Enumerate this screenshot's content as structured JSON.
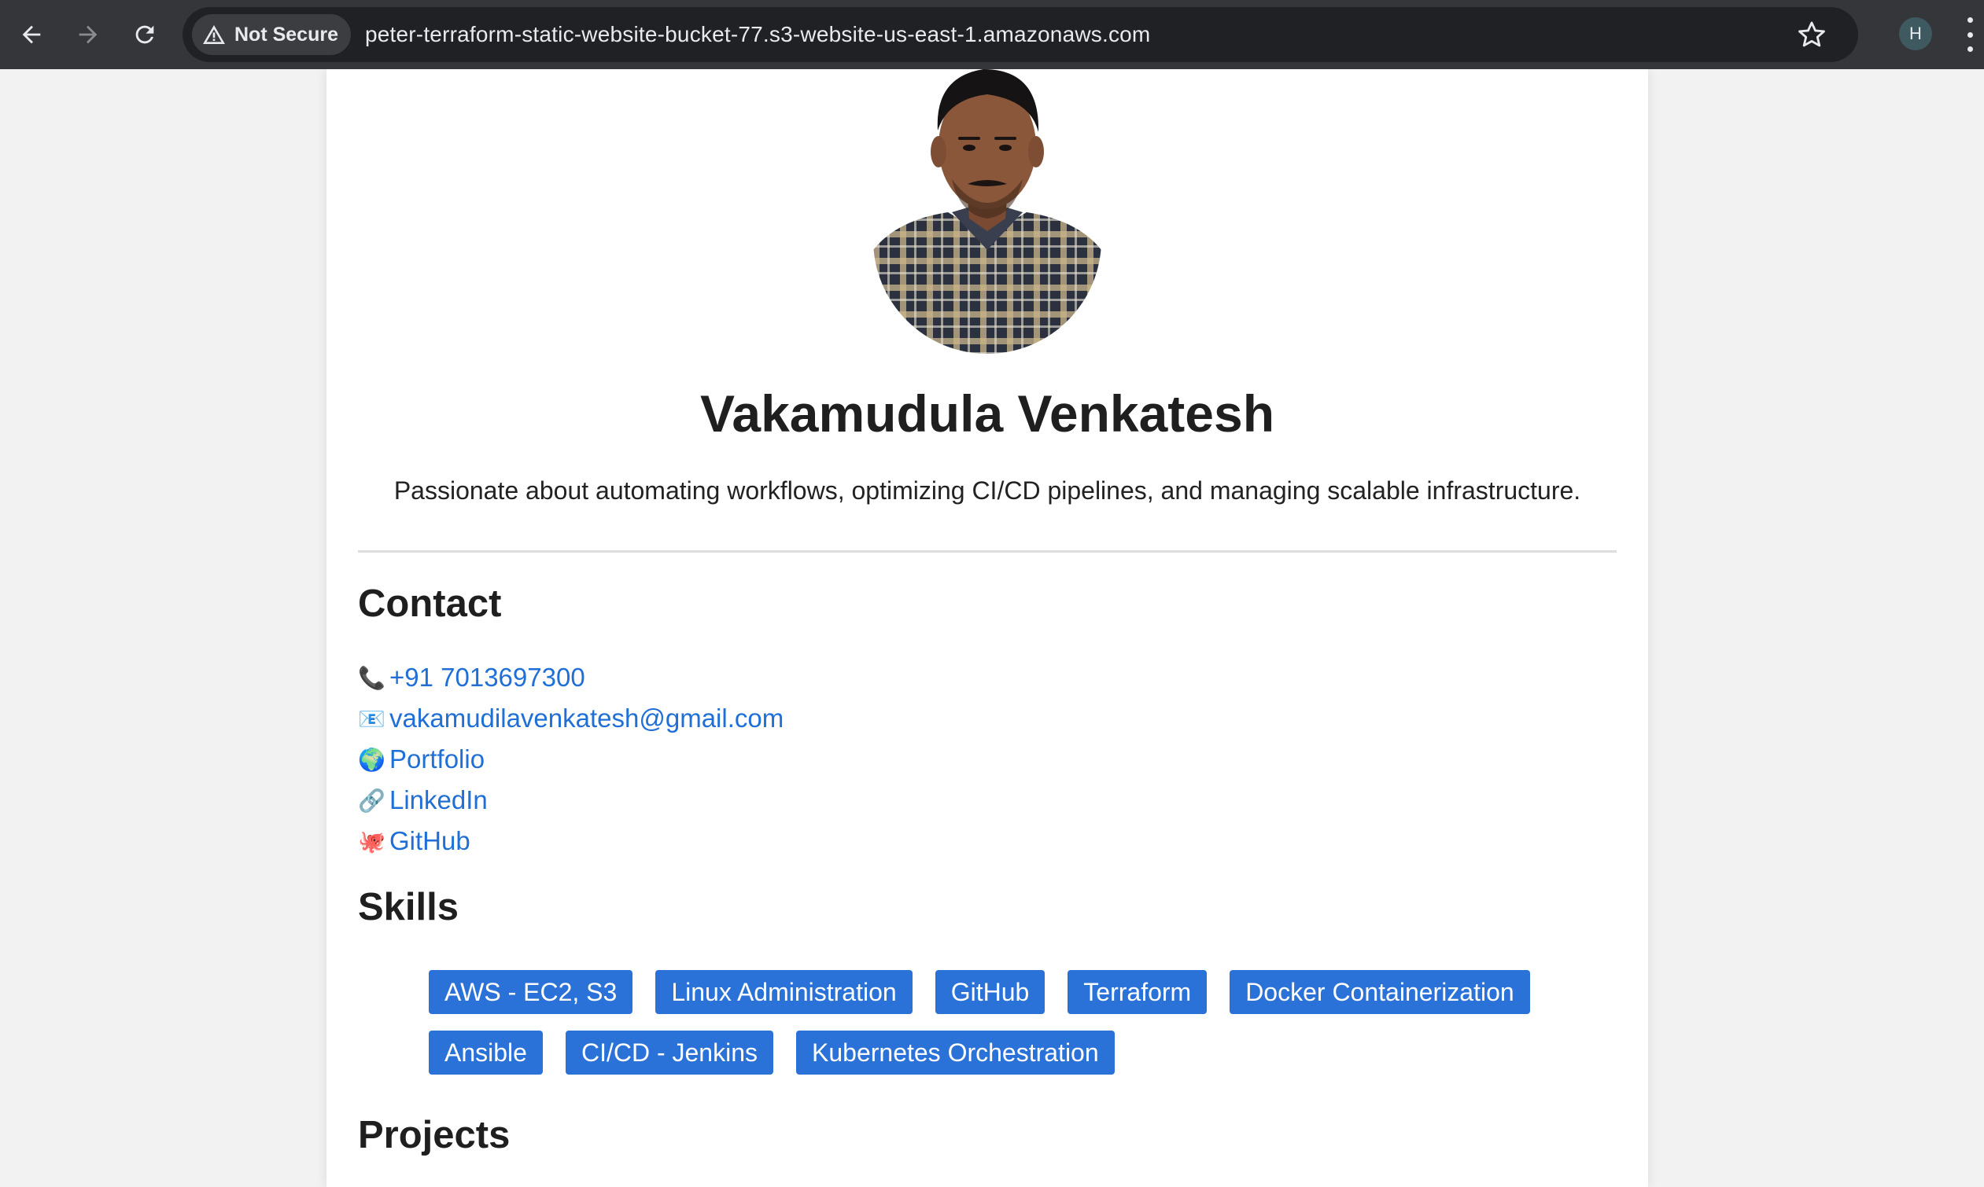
{
  "browser": {
    "security_label": "Not Secure",
    "url": "peter-terraform-static-website-bucket-77.s3-website-us-east-1.amazonaws.com",
    "profile_initial": "H"
  },
  "profile": {
    "name": "Vakamudula Venkatesh",
    "tagline": "Passionate about automating workflows, optimizing CI/CD pipelines, and managing scalable infrastructure."
  },
  "contact": {
    "title": "Contact",
    "items": [
      {
        "icon": "phone-icon",
        "glyph": "📞",
        "label": "+91 7013697300"
      },
      {
        "icon": "email-icon",
        "glyph": "📧",
        "label": "vakamudilavenkatesh@gmail.com"
      },
      {
        "icon": "globe-icon",
        "glyph": "🌍",
        "label": "Portfolio"
      },
      {
        "icon": "link-icon",
        "glyph": "🔗",
        "label": "LinkedIn"
      },
      {
        "icon": "octopus-icon",
        "glyph": "🐙",
        "label": "GitHub"
      }
    ]
  },
  "skills": {
    "title": "Skills",
    "items": [
      "AWS - EC2, S3",
      "Linux Administration",
      "GitHub",
      "Terraform",
      "Docker Containerization",
      "Ansible",
      "CI/CD - Jenkins",
      "Kubernetes Orchestration"
    ]
  },
  "projects": {
    "title": "Projects"
  },
  "colors": {
    "link": "#1f6fd6",
    "skill_bg": "#2a72d8",
    "chrome_bg": "#35363a"
  }
}
